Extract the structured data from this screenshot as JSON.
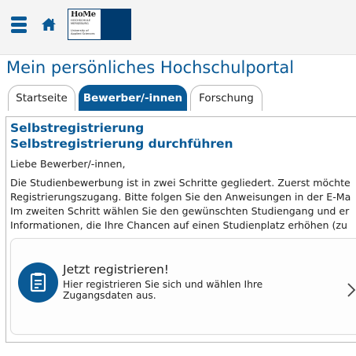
{
  "header": {
    "menu_icon": "hamburger-menu-icon",
    "home_icon": "home-icon",
    "logo": {
      "wordmark": "HoMe",
      "lines": [
        "HOCHSCHULE",
        "MERSEBURG"
      ],
      "subline": [
        "University of",
        "Applied Sciences"
      ]
    }
  },
  "page": {
    "title": "Mein persönliches Hochschulportal"
  },
  "tabs": [
    {
      "label": "Startseite",
      "active": false
    },
    {
      "label": "Bewerber/-innen",
      "active": true
    },
    {
      "label": "Forschung",
      "active": false
    }
  ],
  "content": {
    "heading1": "Selbstregistrierung",
    "heading2": "Selbstregistrierung durchführen",
    "greeting": "Liebe Bewerber/-innen,",
    "paragraph_lines": [
      "Die Studienbewerbung ist in zwei Schritte gegliedert. Zuerst möchte",
      "Registrierungszugang. Bitte folgen Sie den Anweisungen in der E-Ma",
      "Im zweiten Schritt wählen Sie den gewünschten Studiengang und er",
      "Informationen, die Ihre Chancen auf einen Studienplatz erhöhen (zu"
    ],
    "card": {
      "icon": "register-form-icon",
      "title": "Jetzt registrieren!",
      "text": "Hier registrieren Sie sich und wählen Ihre Zugangsdaten aus.",
      "chevron_icon": "chevron-right-icon"
    }
  },
  "colors": {
    "primary": "#0a5a96",
    "logo_blue": "#003b6f",
    "header_bg": "#f4f4f4",
    "border": "#b9b9b9"
  }
}
